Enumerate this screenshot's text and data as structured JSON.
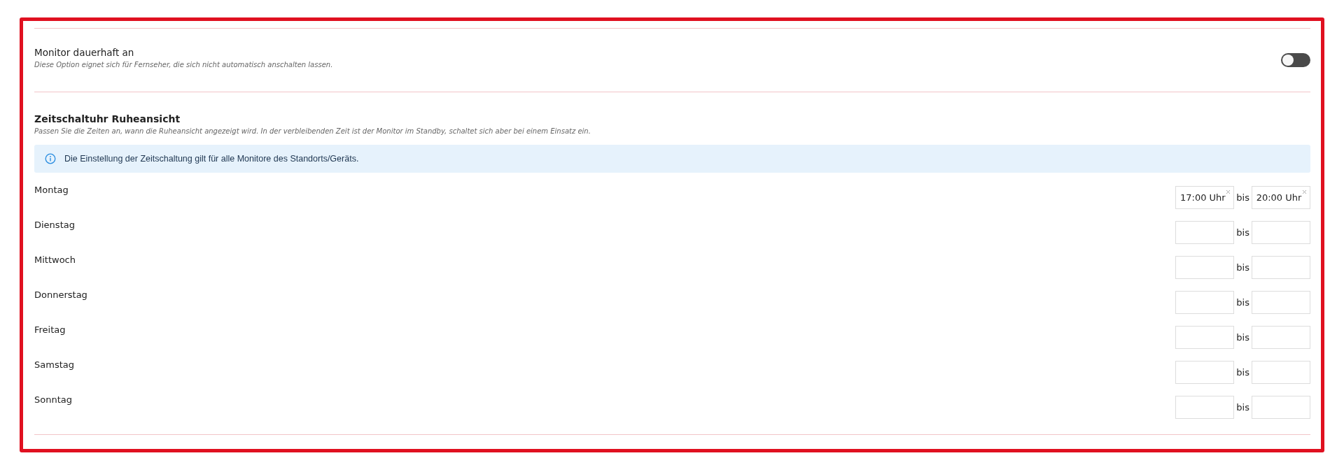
{
  "monitor_setting": {
    "title": "Monitor dauerhaft an",
    "description": "Diese Option eignet sich für Fernseher, die sich nicht automatisch anschalten lassen.",
    "on": false
  },
  "timer": {
    "title": "Zeitschaltuhr Ruheansicht",
    "description": "Passen Sie die Zeiten an, wann die Ruheansicht angezeigt wird. In der verbleibenden Zeit ist der Monitor im Standby, schaltet sich aber bei einem Einsatz ein.",
    "info": "Die Einstellung der Zeitschaltung gilt für alle Monitore des Standorts/Geräts.",
    "days": [
      {
        "day": "Montag",
        "from": "17:00 Uhr",
        "separator": "bis",
        "to": "20:00 Uhr"
      },
      {
        "day": "Dienstag",
        "separator": "bis"
      },
      {
        "day": "Mittwoch",
        "separator": "bis"
      },
      {
        "day": "Donnerstag",
        "separator": "bis"
      },
      {
        "day": "Freitag",
        "separator": "bis"
      },
      {
        "day": "Samstag",
        "separator": "bis"
      },
      {
        "day": "Sonntag",
        "separator": "bis"
      }
    ]
  }
}
